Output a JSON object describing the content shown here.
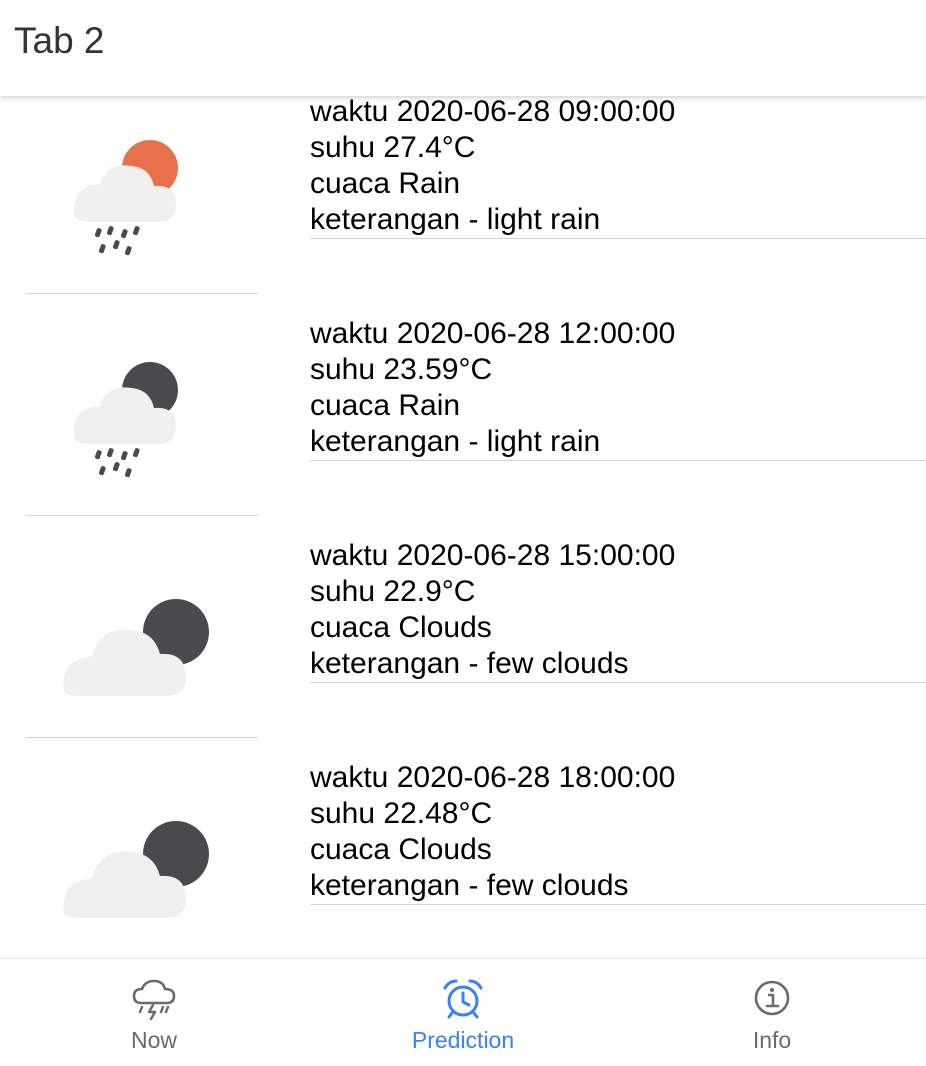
{
  "header": {
    "title": "Tab 2"
  },
  "forecast": [
    {
      "icon": "rain-day-icon",
      "waktu": "waktu 2020-06-28 09:00:00",
      "suhu": "suhu 27.4°C",
      "cuaca": "cuaca Rain",
      "keterangan": "keterangan - light rain"
    },
    {
      "icon": "rain-night-icon",
      "waktu": "waktu 2020-06-28 12:00:00",
      "suhu": "suhu 23.59°C",
      "cuaca": "cuaca Rain",
      "keterangan": "keterangan - light rain"
    },
    {
      "icon": "cloud-night-icon",
      "waktu": "waktu 2020-06-28 15:00:00",
      "suhu": "suhu 22.9°C",
      "cuaca": "cuaca Clouds",
      "keterangan": "keterangan - few clouds"
    },
    {
      "icon": "cloud-night-icon",
      "waktu": "waktu 2020-06-28 18:00:00",
      "suhu": "suhu 22.48°C",
      "cuaca": "cuaca Clouds",
      "keterangan": "keterangan - few clouds"
    }
  ],
  "tabbar": {
    "tabs": [
      {
        "label": "Now",
        "icon": "thunderstorm-icon",
        "active": false
      },
      {
        "label": "Prediction",
        "icon": "alarm-clock-icon",
        "active": true
      },
      {
        "label": "Info",
        "icon": "info-icon",
        "active": false
      }
    ]
  },
  "colors": {
    "accent": "#3880ff",
    "sun": "#e8704a",
    "moon": "#4a4a4d",
    "cloud": "#f0f0f0",
    "inactive": "#6a6a6a"
  }
}
